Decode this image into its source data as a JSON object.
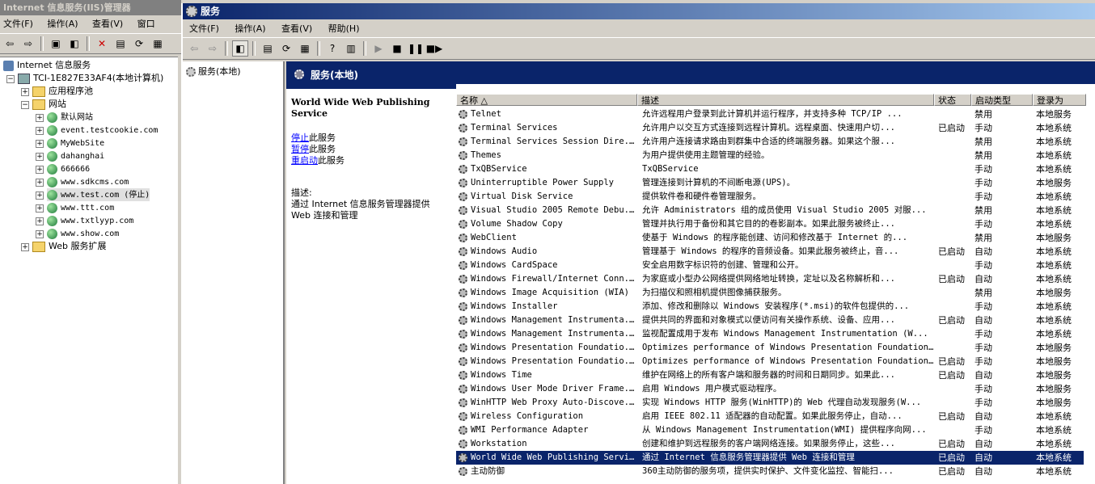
{
  "iis_window": {
    "title": "Internet 信息服务(IIS)管理器",
    "menu": [
      "文件(F)",
      "操作(A)",
      "查看(V)",
      "窗口"
    ],
    "tree": {
      "root": "Internet 信息服务",
      "computer": "TCI-1E827E33AF4(本地计算机)",
      "app_pools": "应用程序池",
      "websites": "网站",
      "sites": [
        "默认网站",
        "event.testcookie.com",
        "MyWebSite",
        "dahanghai",
        "666666",
        "www.sdkcms.com",
        "www.test.com (停止)",
        "www.ttt.com",
        "www.txtlyyp.com",
        "www.show.com"
      ],
      "web_ext": "Web 服务扩展"
    }
  },
  "services_window": {
    "title": "服务",
    "menu": [
      "文件(F)",
      "操作(A)",
      "查看(V)",
      "帮助(H)"
    ],
    "scope_node": "服务(本地)",
    "band_title": "服务(本地)",
    "extended": {
      "service_name": "World Wide Web Publishing Service",
      "link_stop": "停止",
      "link_stop_suffix": "此服务",
      "link_pause": "暂停",
      "link_pause_suffix": "此服务",
      "link_restart": "重启动",
      "link_restart_suffix": "此服务",
      "desc_label": "描述:",
      "desc_text": "通过 Internet 信息服务管理器提供 Web 连接和管理"
    },
    "columns": [
      "名称 △",
      "描述",
      "状态",
      "启动类型",
      "登录为"
    ],
    "rows": [
      {
        "name": "Telnet",
        "desc": "允许远程用户登录到此计算机并运行程序，并支持多种 TCP/IP ...",
        "status": "",
        "startup": "禁用",
        "logon": "本地服务"
      },
      {
        "name": "Terminal Services",
        "desc": "允许用户以交互方式连接到远程计算机。远程桌面、快速用户切...",
        "status": "已启动",
        "startup": "手动",
        "logon": "本地系统"
      },
      {
        "name": "Terminal Services Session Dire...",
        "desc": "允许用户连接请求路由到群集中合适的终端服务器。如果这个服...",
        "status": "",
        "startup": "禁用",
        "logon": "本地系统"
      },
      {
        "name": "Themes",
        "desc": "为用户提供使用主题管理的经验。",
        "status": "",
        "startup": "禁用",
        "logon": "本地系统"
      },
      {
        "name": "TxQBService",
        "desc": "TxQBService",
        "status": "",
        "startup": "手动",
        "logon": "本地系统"
      },
      {
        "name": "Uninterruptible Power Supply",
        "desc": "管理连接到计算机的不间断电源(UPS)。",
        "status": "",
        "startup": "手动",
        "logon": "本地服务"
      },
      {
        "name": "Virtual Disk Service",
        "desc": "提供软件卷和硬件卷管理服务。",
        "status": "",
        "startup": "手动",
        "logon": "本地系统"
      },
      {
        "name": "Visual Studio 2005 Remote Debu...",
        "desc": "允许 Administrators 组的成员使用 Visual Studio 2005 对服...",
        "status": "",
        "startup": "禁用",
        "logon": "本地系统"
      },
      {
        "name": "Volume Shadow Copy",
        "desc": "管理并执行用于备份和其它目的的卷影副本。如果此服务被终止...",
        "status": "",
        "startup": "手动",
        "logon": "本地系统"
      },
      {
        "name": "WebClient",
        "desc": "使基于 Windows 的程序能创建、访问和修改基于 Internet 的...",
        "status": "",
        "startup": "禁用",
        "logon": "本地服务"
      },
      {
        "name": "Windows Audio",
        "desc": "管理基于 Windows 的程序的音频设备。如果此服务被终止，音...",
        "status": "已启动",
        "startup": "自动",
        "logon": "本地系统"
      },
      {
        "name": "Windows CardSpace",
        "desc": "安全启用数字标识符的创建、管理和公开。",
        "status": "",
        "startup": "手动",
        "logon": "本地系统"
      },
      {
        "name": "Windows Firewall/Internet Conn...",
        "desc": "为家庭或小型办公网络提供网络地址转换，定址以及名称解析和...",
        "status": "已启动",
        "startup": "自动",
        "logon": "本地系统"
      },
      {
        "name": "Windows Image Acquisition (WIA)",
        "desc": "为扫描仪和照相机提供图像捕获服务。",
        "status": "",
        "startup": "禁用",
        "logon": "本地服务"
      },
      {
        "name": "Windows Installer",
        "desc": "添加、修改和删除以 Windows 安装程序(*.msi)的软件包提供的...",
        "status": "",
        "startup": "手动",
        "logon": "本地系统"
      },
      {
        "name": "Windows Management Instrumenta...",
        "desc": "提供共同的界面和对象模式以便访问有关操作系统、设备、应用...",
        "status": "已启动",
        "startup": "自动",
        "logon": "本地系统"
      },
      {
        "name": "Windows Management Instrumenta...",
        "desc": "监视配置成用于发布 Windows Management Instrumentation (W...",
        "status": "",
        "startup": "手动",
        "logon": "本地系统"
      },
      {
        "name": "Windows Presentation Foundatio...",
        "desc": "Optimizes performance of Windows Presentation Foundation...",
        "status": "",
        "startup": "手动",
        "logon": "本地服务"
      },
      {
        "name": "Windows Presentation Foundatio...",
        "desc": "Optimizes performance of Windows Presentation Foundation...",
        "status": "已启动",
        "startup": "手动",
        "logon": "本地服务"
      },
      {
        "name": "Windows Time",
        "desc": "维护在网络上的所有客户端和服务器的时间和日期同步。如果此...",
        "status": "已启动",
        "startup": "自动",
        "logon": "本地服务"
      },
      {
        "name": "Windows User Mode Driver Frame...",
        "desc": "启用 Windows 用户模式驱动程序。",
        "status": "",
        "startup": "手动",
        "logon": "本地服务"
      },
      {
        "name": "WinHTTP Web Proxy Auto-Discove...",
        "desc": "实现 Windows HTTP 服务(WinHTTP)的 Web 代理自动发现服务(W...",
        "status": "",
        "startup": "手动",
        "logon": "本地服务"
      },
      {
        "name": "Wireless Configuration",
        "desc": "启用 IEEE 802.11 适配器的自动配置。如果此服务停止，自动...",
        "status": "已启动",
        "startup": "自动",
        "logon": "本地系统"
      },
      {
        "name": "WMI Performance Adapter",
        "desc": "从 Windows Management Instrumentation(WMI) 提供程序向网...",
        "status": "",
        "startup": "手动",
        "logon": "本地系统"
      },
      {
        "name": "Workstation",
        "desc": "创建和维护到远程服务的客户端网络连接。如果服务停止，这些...",
        "status": "已启动",
        "startup": "自动",
        "logon": "本地系统"
      },
      {
        "name": "World Wide Web Publishing Service",
        "desc": "通过 Internet 信息服务管理器提供 Web 连接和管理",
        "status": "已启动",
        "startup": "自动",
        "logon": "本地系统",
        "selected": true
      },
      {
        "name": "主动防御",
        "desc": "360主动防御的服务项，提供实时保护、文件变化监控、智能扫...",
        "status": "已启动",
        "startup": "自动",
        "logon": "本地系统"
      }
    ]
  },
  "colors": {
    "title_active": "#0a246a",
    "selection": "#0a246a",
    "link": "#0000ff",
    "face": "#d4d0c8"
  }
}
